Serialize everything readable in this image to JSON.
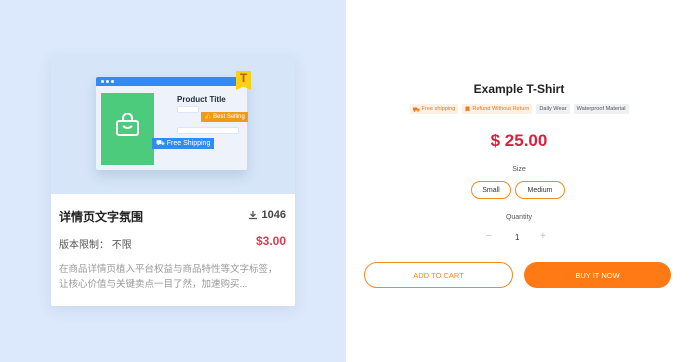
{
  "template_card": {
    "preview": {
      "product_title": "Product Title",
      "best_selling_label": "Best Selling",
      "free_shipping_label": "Free Shipping",
      "flag_letter": "T"
    },
    "title": "详情页文字氛围",
    "download_count": "1046",
    "version_limit": "版本限制： 不限",
    "price": "$3.00",
    "description": "在商品详情页植入平台权益与商品特性等文字标签，让核心价值与关键卖点一目了然，加速购买..."
  },
  "product": {
    "title": "Example T-Shirt",
    "tags": [
      {
        "label": "Free shipping",
        "style": "orange",
        "icon": "truck-icon"
      },
      {
        "label": "Refund Without Return",
        "style": "orange",
        "icon": "refund-icon"
      },
      {
        "label": "Daily Wear",
        "style": "gray"
      },
      {
        "label": "Waterproof Material",
        "style": "gray"
      }
    ],
    "price": "$ 25.00",
    "size_label": "Size",
    "sizes": [
      "Small",
      "Medium"
    ],
    "quantity_label": "Quantity",
    "quantity": "1",
    "minus": "−",
    "plus": "+",
    "add_to_cart": "ADD TO CART",
    "buy_now": "BUY IT NOW"
  },
  "colors": {
    "left_bg": "#dce8fb",
    "accent_orange": "#ff7a14",
    "price_red": "#d9213e",
    "mock_blue": "#2f8cf4",
    "mock_green": "#4ccb7d"
  }
}
